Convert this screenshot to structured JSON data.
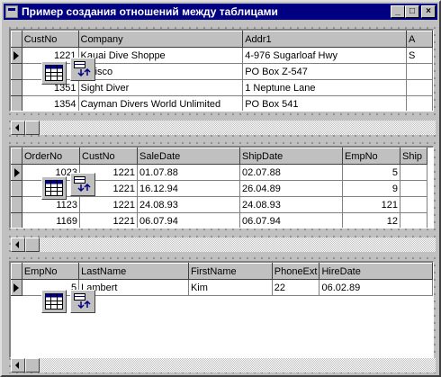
{
  "window": {
    "title": "Пример создания отношений между таблицами",
    "minimize_glyph": "_",
    "maximize_glyph": "□",
    "close_glyph": "×"
  },
  "customers": {
    "columns": [
      "CustNo",
      "Company",
      "Addr1",
      "A"
    ],
    "rows": [
      {
        "CustNo": "1221",
        "Company": "Kauai Dive Shoppe",
        "Addr1": "4-976 Sugarloaf Hwy",
        "A": "S"
      },
      {
        "CustNo": "",
        "Company": "nisco",
        "Addr1": "PO Box Z-547",
        "A": ""
      },
      {
        "CustNo": "1351",
        "Company": "Sight Diver",
        "Addr1": "1 Neptune Lane",
        "A": ""
      },
      {
        "CustNo": "1354",
        "Company": "Cayman Divers World Unlimited",
        "Addr1": "PO Box 541",
        "A": ""
      }
    ]
  },
  "orders": {
    "columns": [
      "OrderNo",
      "CustNo",
      "SaleDate",
      "ShipDate",
      "EmpNo",
      "Ship"
    ],
    "rows": [
      {
        "OrderNo": "1023",
        "CustNo": "1221",
        "SaleDate": "01.07.88",
        "ShipDate": "02.07.88",
        "EmpNo": "5"
      },
      {
        "OrderNo": "",
        "CustNo": "1221",
        "SaleDate": "16.12.94",
        "ShipDate": "26.04.89",
        "EmpNo": "9"
      },
      {
        "OrderNo": "1123",
        "CustNo": "1221",
        "SaleDate": "24.08.93",
        "ShipDate": "24.08.93",
        "EmpNo": "121"
      },
      {
        "OrderNo": "1169",
        "CustNo": "1221",
        "SaleDate": "06.07.94",
        "ShipDate": "06.07.94",
        "EmpNo": "12"
      }
    ]
  },
  "employees": {
    "columns": [
      "EmpNo",
      "LastName",
      "FirstName",
      "PhoneExt",
      "HireDate"
    ],
    "rows": [
      {
        "EmpNo": "5",
        "LastName": "Lambert",
        "FirstName": "Kim",
        "PhoneExt": "22",
        "HireDate": "06.02.89"
      }
    ]
  },
  "components": [
    "table-component-icon",
    "datasource-component-icon"
  ]
}
